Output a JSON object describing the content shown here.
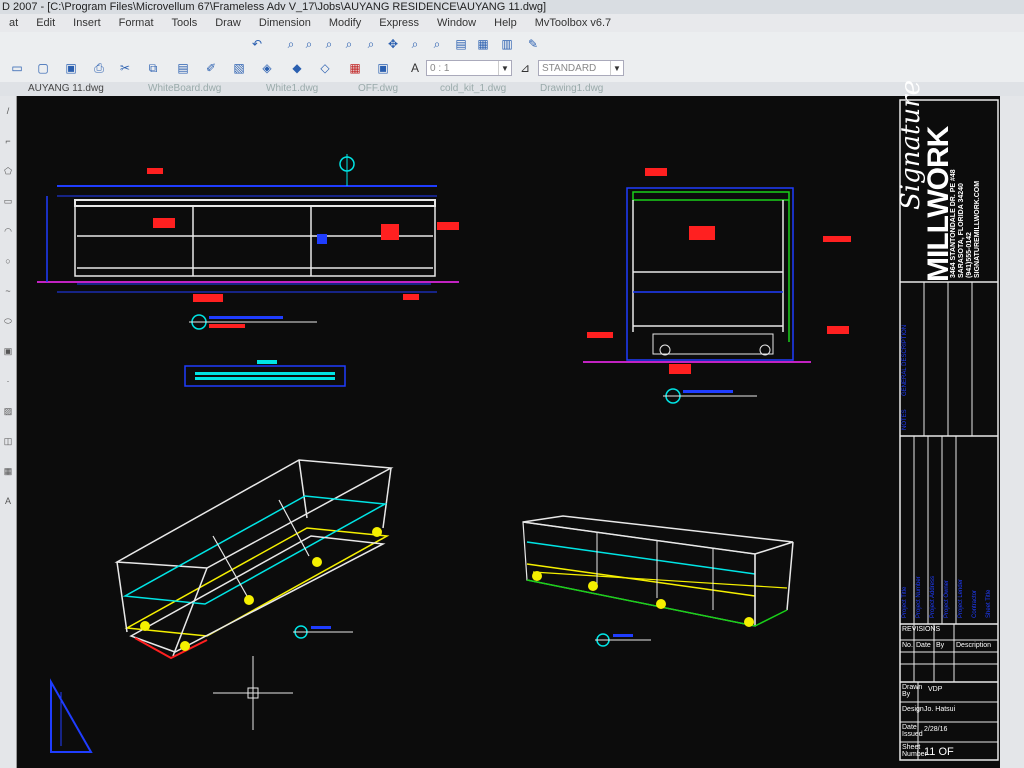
{
  "window": {
    "title": "D 2007 - [C:\\Program Files\\Microvellum 67\\Frameless Adv V_17\\Jobs\\AUYANG RESIDENCE\\AUYANG 11.dwg]"
  },
  "menu": {
    "items": [
      "at",
      "Edit",
      "Insert",
      "Format",
      "Tools",
      "Draw",
      "Dimension",
      "Modify",
      "Express",
      "Window",
      "Help",
      "MvToolbox v6.7"
    ]
  },
  "toolbar": {
    "layer_combo": "0 : 1",
    "linetype_combo": "STANDARD"
  },
  "tabs": [
    {
      "label": "AUYANG 11.dwg",
      "active": true
    },
    {
      "label": "WhiteBoard.dwg",
      "active": false
    },
    {
      "label": "White1.dwg",
      "active": false
    },
    {
      "label": "OFF.dwg",
      "active": false
    },
    {
      "label": "cold_kit_1.dwg",
      "active": false
    },
    {
      "label": "Drawing1.dwg",
      "active": false
    }
  ],
  "title_block": {
    "brand_script": "Signature",
    "brand_main": "MILLWORK",
    "address_lines": [
      "3464 STANTONDALE DR. PE #48",
      "SARASOTA, FLORIDA 34240",
      "(941)555-0142",
      "SIGNATUREMILLWORK.COM"
    ],
    "revision_header": "REVISIONS",
    "revision_columns": [
      "No.",
      "Date",
      "By",
      "Description"
    ],
    "drawn_by_label": "Drawn By",
    "drawn_by": "VDP",
    "design_label": "Design",
    "design_value": "Jo. Hatsui",
    "date_label": "Date Issued",
    "date_value": "2/28/16",
    "sheet_label": "Sheet Number",
    "sheet_value": "11 OF",
    "project_fields": [
      "Project Title",
      "Project Number",
      "Project Address",
      "Project Owner",
      "Project Lender",
      "Contractor",
      "Sheet Title"
    ],
    "sheet_desc": "GENERAL DESCRIPTION",
    "notes_label": "NOTES"
  },
  "drawing": {
    "views": [
      "FRONT ELEVATION",
      "SIDE SECTION",
      "ISOMETRIC VIEW 1",
      "ISOMETRIC VIEW 2"
    ]
  },
  "colors": {
    "cad_bg": "#0c0c0c",
    "blue": "#1f3dff",
    "white": "#e8e8e8",
    "cyan": "#00e5e5",
    "yellow": "#f5f000",
    "red": "#ff2020",
    "green": "#19d019",
    "magenta": "#ff2aff"
  }
}
